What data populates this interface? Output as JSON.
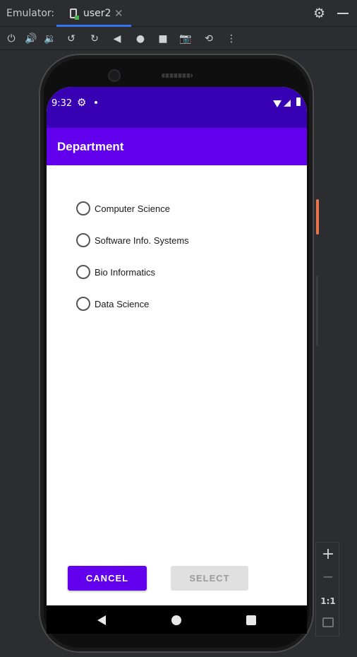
{
  "window": {
    "title": "Emulator:",
    "tab_label": "user2",
    "tab_close": "✕",
    "gear": "⚙",
    "icons": {
      "tab_device": "phone-device-icon",
      "settings": "gear-icon",
      "minimize": "minimize-icon"
    }
  },
  "toolbar": {
    "items": [
      {
        "name": "power-icon",
        "glyph": "⏻"
      },
      {
        "name": "volume-up-icon",
        "glyph": "🔊"
      },
      {
        "name": "volume-down-icon",
        "glyph": "🔉"
      },
      {
        "name": "rotate-left-icon",
        "glyph": "↺"
      },
      {
        "name": "rotate-right-icon",
        "glyph": "↻"
      },
      {
        "name": "back-icon",
        "glyph": "◀"
      },
      {
        "name": "home-icon",
        "glyph": "●"
      },
      {
        "name": "overview-icon",
        "glyph": "■"
      },
      {
        "name": "camera-icon",
        "glyph": "📷"
      },
      {
        "name": "snapshot-icon",
        "glyph": "⟲"
      },
      {
        "name": "more-icon",
        "glyph": "⋮"
      }
    ]
  },
  "device": {
    "status_bar": {
      "time": "9:32",
      "gear": "⚙"
    },
    "app_bar": {
      "title": "Department"
    },
    "options": [
      {
        "label": "Computer Science",
        "selected": false
      },
      {
        "label": "Software Info. Systems",
        "selected": false
      },
      {
        "label": "Bio Informatics",
        "selected": false
      },
      {
        "label": "Data Science",
        "selected": false
      }
    ],
    "buttons": {
      "cancel": "CANCEL",
      "select": "SELECT",
      "select_enabled": false
    },
    "colors": {
      "status_bar": "#3700b3",
      "app_bar": "#6200ee",
      "primary_button": "#6200ee",
      "disabled_button": "#e0e0e0"
    }
  },
  "zoom_panel": {
    "plus": "+",
    "minus": "−",
    "actual_size": "1:1"
  }
}
